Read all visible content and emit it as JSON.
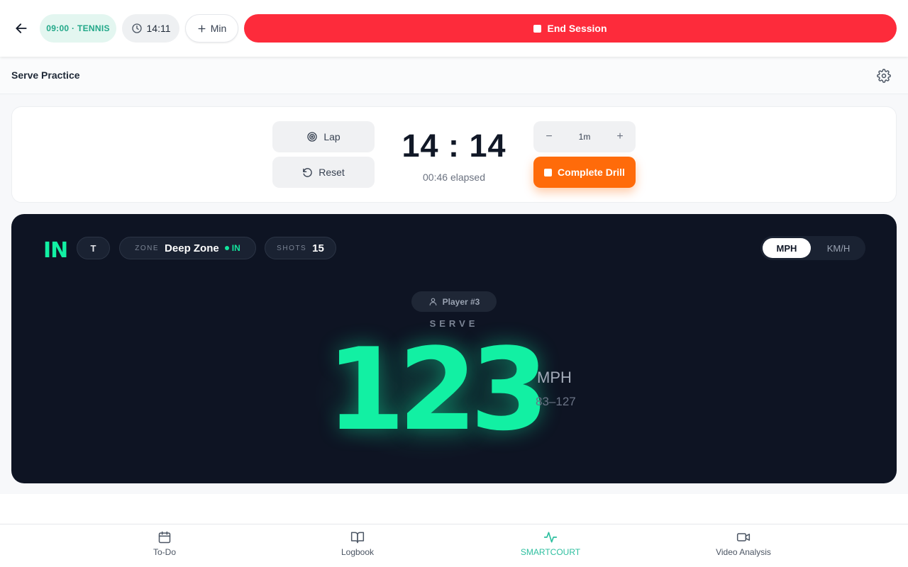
{
  "topbar": {
    "session_label": "09:00 · TENNIS",
    "clock_time": "14:11",
    "add_min_label": "Min",
    "end_session_label": "End Session"
  },
  "subheader": {
    "title": "Serve Practice"
  },
  "timer": {
    "lap_label": "Lap",
    "reset_label": "Reset",
    "display": "14 : 14",
    "elapsed": "00:46 elapsed",
    "step_value": "1m",
    "complete_label": "Complete Drill"
  },
  "speed_panel": {
    "call_logo": "IN",
    "target_chip": "T",
    "zone_key": "ZONE",
    "zone_value": "Deep Zone",
    "zone_status": "IN",
    "shots_key": "SHOTS",
    "shots_value": "15",
    "units": [
      "MPH",
      "KM/H"
    ],
    "selected_unit": "MPH",
    "player": "Player #3",
    "stroke": "SERVE",
    "speed": "123",
    "speed_unit": "MPH",
    "speed_range": "83–127",
    "accent_color": "#12f0a3"
  },
  "nav": {
    "items": [
      {
        "label": "To-Do",
        "icon": "calendar-icon"
      },
      {
        "label": "Logbook",
        "icon": "book-icon"
      },
      {
        "label": "SMARTCOURT",
        "icon": "activity-icon",
        "active": true
      },
      {
        "label": "Video Analysis",
        "icon": "video-icon"
      }
    ]
  },
  "colors": {
    "end_session": "#fd2b3b",
    "complete_drill": "#ff6b0a",
    "active_nav": "#2dbf9f",
    "panel_bg": "#0e1423"
  }
}
